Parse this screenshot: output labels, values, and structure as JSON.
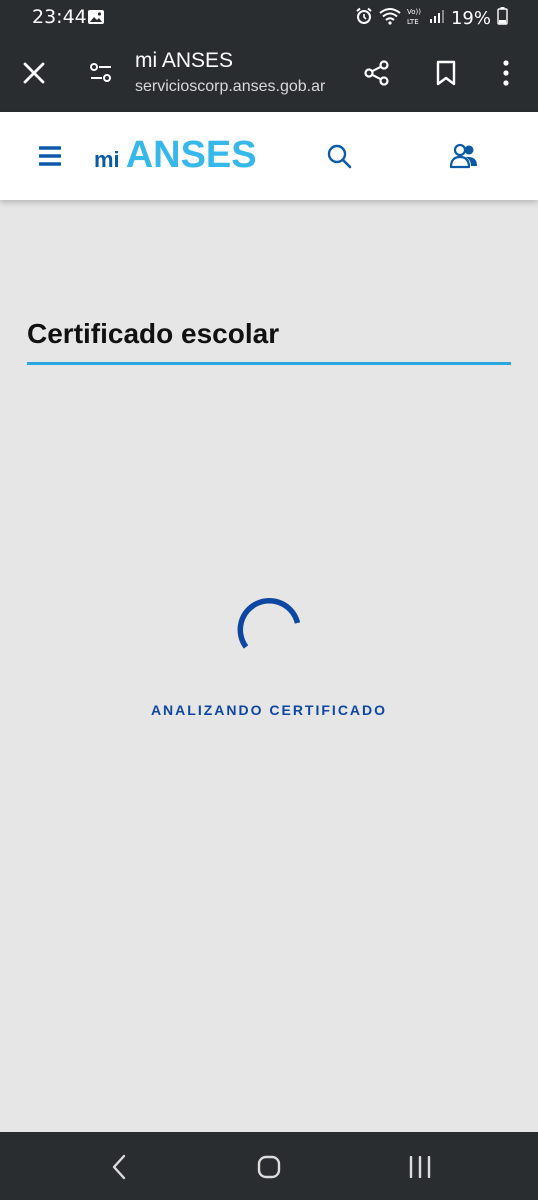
{
  "status_bar": {
    "time": "23:44",
    "battery": "19%",
    "icons": [
      "image-icon",
      "alarm-icon",
      "wifi-icon",
      "volte-icon",
      "signal-icon",
      "battery-icon"
    ]
  },
  "browser": {
    "title": "mi ANSES",
    "url": "servicioscorp.anses.gob.ar",
    "icons": [
      "close-icon",
      "site-settings-icon",
      "share-icon",
      "bookmark-icon",
      "more-icon"
    ]
  },
  "header": {
    "logo_mi": "mi",
    "logo_anses": "ANSES",
    "icons": [
      "menu-icon",
      "search-icon",
      "account-icon"
    ],
    "colors": {
      "primary": "#0a5aa6",
      "accent": "#37b8ea"
    }
  },
  "main": {
    "title": "Certificado escolar",
    "loading_text": "ANALIZANDO CERTIFICADO"
  },
  "nav_bar": {
    "icons": [
      "back-icon",
      "home-icon",
      "recents-icon"
    ]
  }
}
